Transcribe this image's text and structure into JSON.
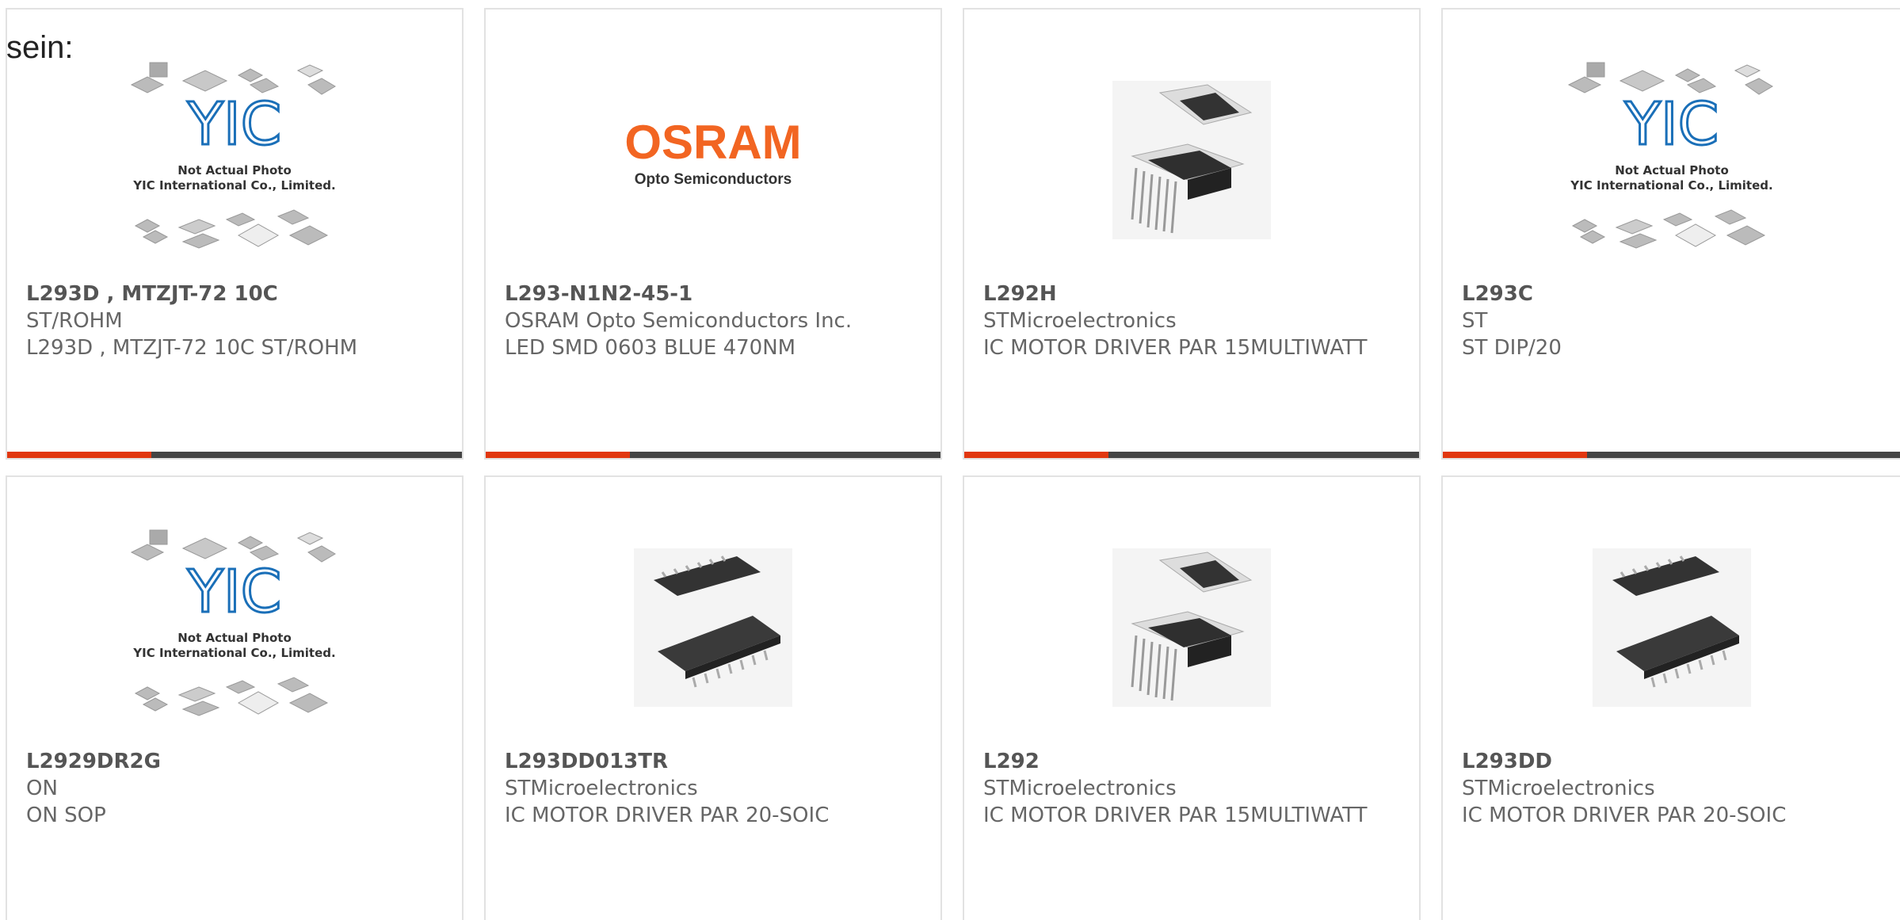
{
  "intro_text": "sein:",
  "placeholder": {
    "logo": "YIC",
    "line1": "Not Actual Photo",
    "line2": "YIC International Co., Limited."
  },
  "osram": {
    "word": "OSRAM",
    "sub": "Opto Semiconductors",
    "color": "#f26522"
  },
  "accent_color": "#e1370f",
  "products": [
    {
      "part": "L293D , MTZJT-72 10C",
      "mfr": "ST/ROHM",
      "desc": "L293D , MTZJT-72 10C ST/ROHM",
      "image": "yic-placeholder"
    },
    {
      "part": "L293-N1N2-45-1",
      "mfr": "OSRAM Opto Semiconductors Inc.",
      "desc": "LED SMD 0603 BLUE 470NM",
      "image": "osram-logo"
    },
    {
      "part": "L292H",
      "mfr": "STMicroelectronics",
      "desc": "IC MOTOR DRIVER PAR 15MULTIWATT",
      "image": "multiwatt-chip"
    },
    {
      "part": "L293C",
      "mfr": "ST",
      "desc": "ST DIP/20",
      "image": "yic-placeholder"
    },
    {
      "part": "L2929DR2G",
      "mfr": "ON",
      "desc": "ON SOP",
      "image": "yic-placeholder"
    },
    {
      "part": "L293DD013TR",
      "mfr": "STMicroelectronics",
      "desc": "IC MOTOR DRIVER PAR 20-SOIC",
      "image": "soic-chip"
    },
    {
      "part": "L292",
      "mfr": "STMicroelectronics",
      "desc": "IC MOTOR DRIVER PAR 15MULTIWATT",
      "image": "multiwatt-chip"
    },
    {
      "part": "L293DD",
      "mfr": "STMicroelectronics",
      "desc": "IC MOTOR DRIVER PAR 20-SOIC",
      "image": "soic-chip"
    }
  ]
}
